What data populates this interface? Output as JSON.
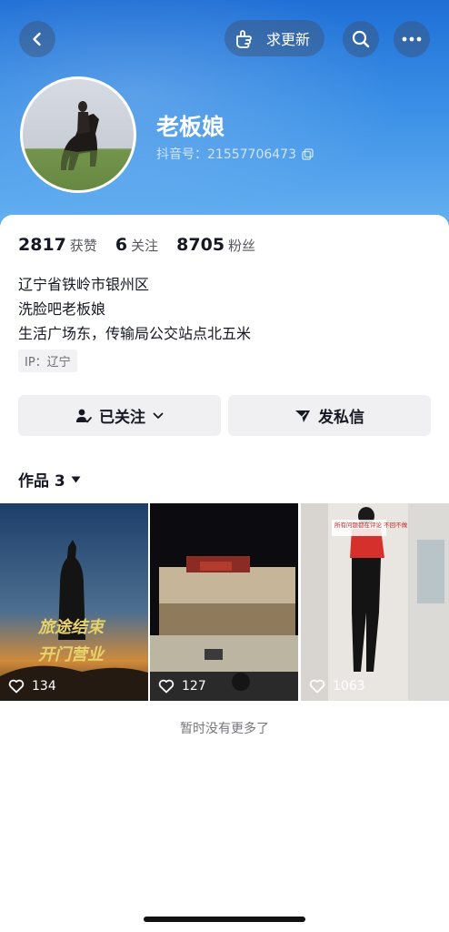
{
  "header": {
    "request_update_label": "求更新"
  },
  "profile": {
    "nickname": "老板娘",
    "douyin_id": "抖音号：21557706473"
  },
  "stats": [
    {
      "value": "2817",
      "label": "获赞"
    },
    {
      "value": "6",
      "label": "关注"
    },
    {
      "value": "8705",
      "label": "粉丝"
    }
  ],
  "bio": {
    "line1": "辽宁省铁岭市银州区",
    "line2": "洗脸吧老板娘",
    "line3": "生活广场东，传输局公交站点北五米",
    "ip": "IP：辽宁"
  },
  "actions": {
    "followed_label": "已关注",
    "message_label": "发私信"
  },
  "works": {
    "tab_label": "作品 3",
    "items": [
      {
        "likes": "134",
        "overlay_line1": "旅途结束",
        "overlay_line2": "开门营业"
      },
      {
        "likes": "127"
      },
      {
        "likes": "1063",
        "overlay_text": "所有问题都在评论\n不回不做"
      }
    ]
  },
  "footer": {
    "no_more": "暂时没有更多了"
  },
  "colors": {
    "header_blue": "#1f6fd6",
    "text_primary": "#161823",
    "button_bg": "#f0f0f2"
  }
}
